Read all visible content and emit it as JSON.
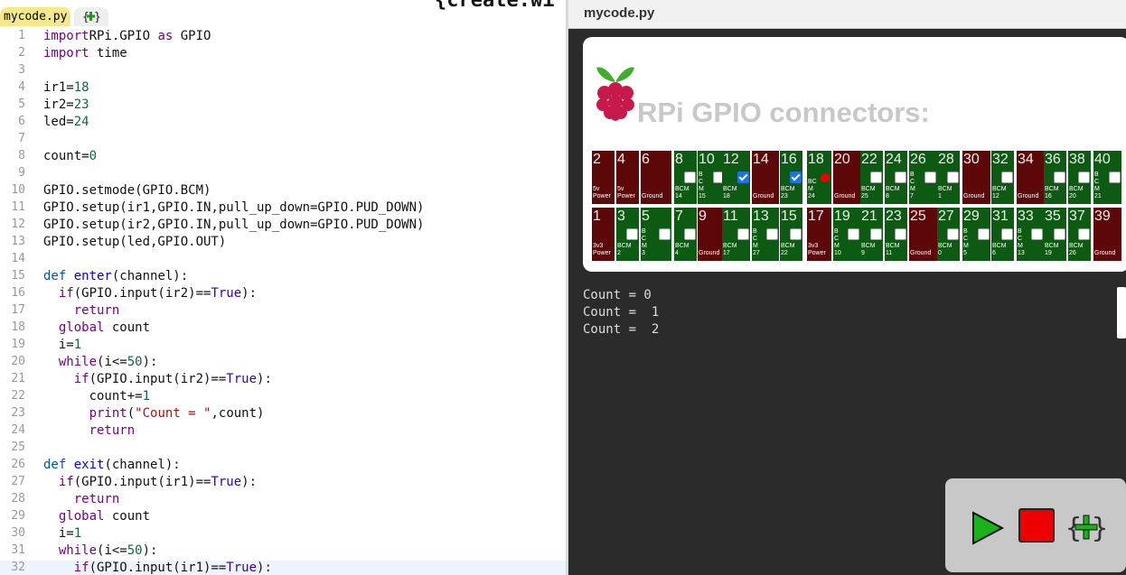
{
  "editor": {
    "tabs": [
      {
        "label": "mycode.py"
      }
    ],
    "new_tab_icon": "add-tab-icon",
    "top_fragment": "{create.wi",
    "lines": [
      {
        "n": "1",
        "t": [
          [
            "kw",
            "import"
          ],
          [
            "",
            "RPi.GPIO "
          ],
          [
            "kw",
            "as"
          ],
          [
            "",
            " GPIO"
          ]
        ]
      },
      {
        "n": "2",
        "t": [
          [
            "kw",
            "import"
          ],
          [
            "",
            " time"
          ]
        ]
      },
      {
        "n": "3",
        "t": []
      },
      {
        "n": "4",
        "t": [
          [
            "",
            "ir1="
          ],
          [
            "nb",
            "18"
          ]
        ]
      },
      {
        "n": "5",
        "t": [
          [
            "",
            "ir2="
          ],
          [
            "nb",
            "23"
          ]
        ]
      },
      {
        "n": "6",
        "t": [
          [
            "",
            "led="
          ],
          [
            "nb",
            "24"
          ]
        ]
      },
      {
        "n": "7",
        "t": []
      },
      {
        "n": "8",
        "t": [
          [
            "",
            "count="
          ],
          [
            "nb",
            "0"
          ]
        ]
      },
      {
        "n": "9",
        "t": []
      },
      {
        "n": "10",
        "t": [
          [
            "",
            "GPIO.setmode(GPIO.BCM)"
          ]
        ]
      },
      {
        "n": "11",
        "t": [
          [
            "",
            "GPIO.setup(ir1,GPIO.IN,pull_up_down=GPIO.PUD_DOWN)"
          ]
        ]
      },
      {
        "n": "12",
        "t": [
          [
            "",
            "GPIO.setup(ir2,GPIO.IN,pull_up_down=GPIO.PUD_DOWN)"
          ]
        ]
      },
      {
        "n": "13",
        "t": [
          [
            "",
            "GPIO.setup(led,GPIO.OUT)"
          ]
        ]
      },
      {
        "n": "14",
        "t": []
      },
      {
        "n": "15",
        "t": [
          [
            "kw2",
            "def "
          ],
          [
            "fn",
            "enter"
          ],
          [
            "",
            "(channel):"
          ]
        ]
      },
      {
        "n": "16",
        "t": [
          [
            "",
            "  "
          ],
          [
            "kw",
            "if"
          ],
          [
            "",
            "(GPIO.input(ir2)=="
          ],
          [
            "bi",
            "True"
          ],
          [
            "",
            "):"
          ]
        ]
      },
      {
        "n": "17",
        "t": [
          [
            "",
            "    "
          ],
          [
            "kw",
            "return"
          ]
        ]
      },
      {
        "n": "18",
        "t": [
          [
            "",
            "  "
          ],
          [
            "kw",
            "global"
          ],
          [
            "",
            " count"
          ]
        ]
      },
      {
        "n": "19",
        "t": [
          [
            "",
            "  i="
          ],
          [
            "nb",
            "1"
          ]
        ]
      },
      {
        "n": "20",
        "t": [
          [
            "",
            "  "
          ],
          [
            "kw",
            "while"
          ],
          [
            "",
            "(i<="
          ],
          [
            "nb",
            "50"
          ],
          [
            "",
            "):"
          ]
        ]
      },
      {
        "n": "21",
        "t": [
          [
            "",
            "    "
          ],
          [
            "kw",
            "if"
          ],
          [
            "",
            "(GPIO.input(ir2)=="
          ],
          [
            "bi",
            "True"
          ],
          [
            "",
            "):"
          ]
        ]
      },
      {
        "n": "22",
        "t": [
          [
            "",
            "      count+="
          ],
          [
            "nb",
            "1"
          ]
        ]
      },
      {
        "n": "23",
        "t": [
          [
            "",
            "      "
          ],
          [
            "kw",
            "print"
          ],
          [
            "",
            "("
          ],
          [
            "str",
            "\"Count = \""
          ],
          [
            "",
            ",count)"
          ]
        ]
      },
      {
        "n": "24",
        "t": [
          [
            "",
            "      "
          ],
          [
            "kw",
            "return"
          ]
        ]
      },
      {
        "n": "25",
        "t": []
      },
      {
        "n": "26",
        "t": [
          [
            "kw2",
            "def "
          ],
          [
            "fn",
            "exit"
          ],
          [
            "",
            "(channel):"
          ]
        ]
      },
      {
        "n": "27",
        "t": [
          [
            "",
            "  "
          ],
          [
            "kw",
            "if"
          ],
          [
            "",
            "(GPIO.input(ir1)=="
          ],
          [
            "bi",
            "True"
          ],
          [
            "",
            "):"
          ]
        ]
      },
      {
        "n": "28",
        "t": [
          [
            "",
            "    "
          ],
          [
            "kw",
            "return"
          ]
        ]
      },
      {
        "n": "29",
        "t": [
          [
            "",
            "  "
          ],
          [
            "kw",
            "global"
          ],
          [
            "",
            " count"
          ]
        ]
      },
      {
        "n": "30",
        "t": [
          [
            "",
            "  i="
          ],
          [
            "nb",
            "1"
          ]
        ]
      },
      {
        "n": "31",
        "t": [
          [
            "",
            "  "
          ],
          [
            "kw",
            "while"
          ],
          [
            "",
            "(i<="
          ],
          [
            "nb",
            "50"
          ],
          [
            "",
            "):"
          ]
        ]
      },
      {
        "n": "32",
        "t": [
          [
            "",
            "    "
          ],
          [
            "kw",
            "if"
          ],
          [
            "",
            "(GPIO.input(ir1)=="
          ],
          [
            "bi",
            "True"
          ],
          [
            "",
            "):"
          ]
        ]
      }
    ],
    "active_line": "32"
  },
  "output": {
    "title": "mycode.py",
    "gpio_title": "RPi GPIO connectors:",
    "top_row": [
      {
        "num": "2",
        "label": "5v\nPower",
        "type": "power"
      },
      {
        "num": "4",
        "label": "5v\nPower",
        "type": "power"
      },
      {
        "num": "6",
        "label": "Ground",
        "type": "power"
      },
      {
        "num": "8",
        "label": "BCM\n14",
        "type": "gpio",
        "checked": false
      },
      {
        "num": "10",
        "label": "B\nC\nM\n15",
        "type": "gpio",
        "checked": false
      },
      {
        "num": "12",
        "label": "BCM\n18",
        "type": "gpio",
        "checked": true
      },
      {
        "num": "14",
        "label": "Ground",
        "type": "power"
      },
      {
        "num": "16",
        "label": "BCM\n23",
        "type": "gpio",
        "checked": true
      },
      {
        "num": "18",
        "label": "BC\nM\n24",
        "type": "gpio",
        "led": true
      },
      {
        "num": "20",
        "label": "Ground",
        "type": "power"
      },
      {
        "num": "22",
        "label": "BCM\n25",
        "type": "gpio",
        "checked": false
      },
      {
        "num": "24",
        "label": "BCM\n8",
        "type": "gpio",
        "checked": false
      },
      {
        "num": "26",
        "label": "B\nC\nM\n7",
        "type": "gpio",
        "checked": false
      },
      {
        "num": "28",
        "label": "BCM\n1",
        "type": "gpio",
        "checked": false
      },
      {
        "num": "30",
        "label": "Ground",
        "type": "power"
      },
      {
        "num": "32",
        "label": "BCM\n12",
        "type": "gpio",
        "checked": false
      },
      {
        "num": "34",
        "label": "Ground",
        "type": "power"
      },
      {
        "num": "36",
        "label": "BCM\n16",
        "type": "gpio",
        "checked": false
      },
      {
        "num": "38",
        "label": "BCM\n20",
        "type": "gpio",
        "checked": false
      },
      {
        "num": "40",
        "label": "B\nC\nM\n21",
        "type": "gpio",
        "checked": false
      }
    ],
    "bottom_row": [
      {
        "num": "1",
        "label": "3v3\nPower",
        "type": "power"
      },
      {
        "num": "3",
        "label": "BCM\n2",
        "type": "gpio",
        "checked": false
      },
      {
        "num": "5",
        "label": "B\nC\nM\n3",
        "type": "gpio",
        "checked": false
      },
      {
        "num": "7",
        "label": "BCM\n4",
        "type": "gpio",
        "checked": false
      },
      {
        "num": "9",
        "label": "Ground",
        "type": "power"
      },
      {
        "num": "11",
        "label": "BCM\n17",
        "type": "gpio",
        "checked": false
      },
      {
        "num": "13",
        "label": "B\nC\nM\n27",
        "type": "gpio",
        "checked": false
      },
      {
        "num": "15",
        "label": "BCM\n22",
        "type": "gpio",
        "checked": false
      },
      {
        "num": "17",
        "label": "3v3\nPower",
        "type": "power"
      },
      {
        "num": "19",
        "label": "B\nC\nM\n10",
        "type": "gpio",
        "checked": false
      },
      {
        "num": "21",
        "label": "BCM\n9",
        "type": "gpio",
        "checked": false
      },
      {
        "num": "23",
        "label": "BCM\n11",
        "type": "gpio",
        "checked": false
      },
      {
        "num": "25",
        "label": "Ground",
        "type": "power"
      },
      {
        "num": "27",
        "label": "BCM\n0",
        "type": "gpio",
        "checked": false
      },
      {
        "num": "29",
        "label": "B\nC\nM\n5",
        "type": "gpio",
        "checked": false
      },
      {
        "num": "31",
        "label": "BCM\n6",
        "type": "gpio",
        "checked": false
      },
      {
        "num": "33",
        "label": "B\nC\nM\n13",
        "type": "gpio",
        "checked": false
      },
      {
        "num": "35",
        "label": "BCM\n19",
        "type": "gpio",
        "checked": false
      },
      {
        "num": "37",
        "label": "BCM\n26",
        "type": "gpio",
        "checked": false
      },
      {
        "num": "39",
        "label": "Ground",
        "type": "power"
      }
    ],
    "console_lines": [
      "Count = 0",
      "Count =  1",
      "Count =  2"
    ],
    "controls": {
      "run_icon": "play-icon",
      "stop_icon": "stop-icon",
      "new_icon": "add-code-icon"
    }
  },
  "colors": {
    "power": "#5c0808",
    "gpio": "#0d5a12",
    "tab_active": "#f4e98a",
    "run": "#19b319",
    "stop": "#e00000"
  }
}
